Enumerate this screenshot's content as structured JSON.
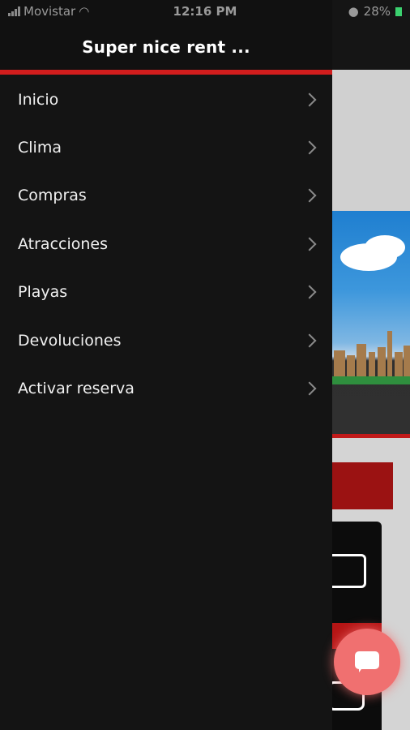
{
  "status_bar": {
    "carrier": "Movistar",
    "time": "12:16 PM",
    "battery": "28%",
    "icons": [
      "signal-icon",
      "wifi-icon",
      "location-icon",
      "battery-icon"
    ]
  },
  "drawer": {
    "title": "Super nice rent ...",
    "accent_color": "#d21d1d",
    "items": [
      {
        "label": "Inicio",
        "icon": "chevron-right-icon"
      },
      {
        "label": "Clima",
        "icon": "chevron-right-icon"
      },
      {
        "label": "Compras",
        "icon": "chevron-right-icon"
      },
      {
        "label": "Atracciones",
        "icon": "chevron-right-icon"
      },
      {
        "label": "Playas",
        "icon": "chevron-right-icon"
      },
      {
        "label": "Devoluciones",
        "icon": "chevron-right-icon"
      },
      {
        "label": "Activar reserva",
        "icon": "chevron-right-icon"
      }
    ]
  },
  "chat_button": {
    "icon": "chat-icon",
    "color": "#f07070"
  }
}
